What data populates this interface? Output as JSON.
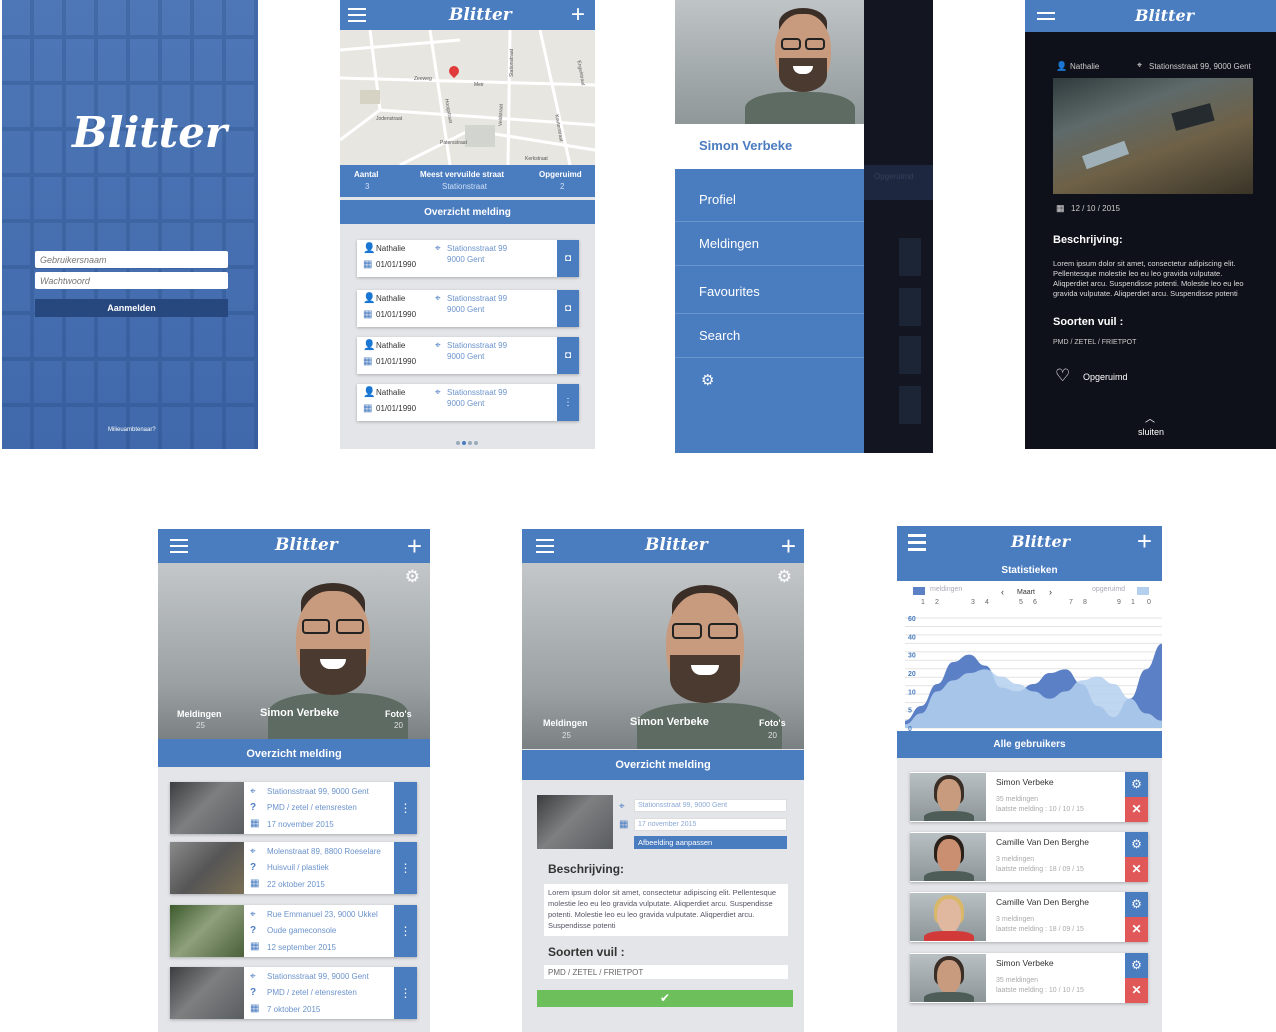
{
  "app": {
    "name": "Blitter"
  },
  "login": {
    "username_placeholder": "Gebruikersnaam",
    "password_placeholder": "Wachtwoord",
    "login_button": "Aanmelden",
    "forgot_link": "Milieuambtenaar?"
  },
  "map_screen": {
    "streets": [
      "Zeeweg",
      "Meir",
      "Stationstraat",
      "Kouterstraat",
      "Veldstraat",
      "Jodenstraat",
      "Hoogstraat",
      "Patersstraat",
      "Kerkstraat",
      "Engelstraat"
    ],
    "stats": [
      {
        "label": "Aantal",
        "value": "3"
      },
      {
        "label": "Meest vervuilde straat",
        "value": "Stationstraat"
      },
      {
        "label": "Opgeruimd",
        "value": "2"
      }
    ],
    "section_title": "Overzicht melding",
    "items": [
      {
        "user": "Nathalie",
        "date": "01/01/1990",
        "street": "Stationsstraat 99",
        "city": "9000 Gent",
        "action": "camera-icon"
      },
      {
        "user": "Nathalie",
        "date": "01/01/1990",
        "street": "Stationsstraat 99",
        "city": "9000 Gent",
        "action": "camera-icon"
      },
      {
        "user": "Nathalie",
        "date": "01/01/1990",
        "street": "Stationsstraat 99",
        "city": "9000 Gent",
        "action": "camera-icon"
      },
      {
        "user": "Nathalie",
        "date": "01/01/1990",
        "street": "Stationsstraat 99",
        "city": "9000 Gent",
        "action": "more-icon"
      }
    ]
  },
  "side_menu": {
    "user_name": "Simon Verbeke",
    "items": [
      "Profiel",
      "Meldingen",
      "Favourites",
      "Search"
    ],
    "bg_label": "Opgeruimd"
  },
  "detail": {
    "user": "Nathalie",
    "location": "Stationsstraat 99, 9000 Gent",
    "date": "12 / 10 / 2015",
    "description_title": "Beschrijving:",
    "description": "Lorem ipsum dolor sit amet, consectetur adipiscing elit. Pellentesque molestie leo eu leo gravida vulputate. Aliqperdiet arcu. Suspendisse potenti. Molestie leo eu leo gravida vulputate. Aliqperdiet arcu. Suspendisse potenti",
    "types_title": "Soorten vuil :",
    "types": "PMD / ZETEL / FRIETPOT",
    "cleaned_label": "Opgeruimd",
    "close_label": "sluiten"
  },
  "profile": {
    "user_name": "Simon Verbeke",
    "stat_left_label": "Meldingen",
    "stat_left_value": "25",
    "stat_right_label": "Foto's",
    "stat_right_value": "20",
    "section_title": "Overzicht melding",
    "items": [
      {
        "address": "Stationsstraat 99, 9000 Gent",
        "types": "PMD / zetel / etensresten",
        "date": "17 november 2015"
      },
      {
        "address": "Molenstraat 89, 8800 Roeselare",
        "types": "Huisvuil / plastiek",
        "date": "22 oktober 2015"
      },
      {
        "address": "Rue Emmanuel 23, 9000 Ukkel",
        "types": "Oude gameconsole",
        "date": "12 september 2015"
      },
      {
        "address": "Stationsstraat 99, 9000 Gent",
        "types": "PMD / zetel / etensresten",
        "date": "7 oktober 2015"
      }
    ]
  },
  "edit": {
    "user_name": "Simon Verbeke",
    "stat_left_label": "Meldingen",
    "stat_left_value": "25",
    "stat_right_label": "Foto's",
    "stat_right_value": "20",
    "section_title": "Overzicht melding",
    "address_value": "Stationsstraat 99, 9000 Gent",
    "date_value": "17 november 2015",
    "change_image_button": "Afbeelding aanpassen",
    "description_title": "Beschrijving:",
    "description": "Lorem ipsum dolor sit amet, consectetur adipiscing elit. Pellentesque molestie leo eu leo gravida vulputate. Aliqperdiet arcu. Suspendisse potenti. Molestie leo eu leo gravida vulputate. Aliqperdiet arcu. Suspendisse potenti",
    "types_title": "Soorten vuil :",
    "types_value": "PMD / ZETEL / FRIETPOT",
    "confirm_icon": "check-icon"
  },
  "stats_screen": {
    "title": "Statistieken",
    "legend_a": "meldingen",
    "legend_b": "opgeruimd",
    "month": "Maart",
    "day_ticks": [
      "1",
      "2",
      "3",
      "4",
      "5",
      "6",
      "7",
      "8",
      "9",
      "1",
      "0"
    ],
    "section_title": "Alle gebruikers",
    "users": [
      {
        "name": "Simon Verbeke",
        "count": "35 meldingen",
        "last": "laatste melding : 10 / 10 / 15"
      },
      {
        "name": "Camille Van Den Berghe",
        "count": "3 meldingen",
        "last": "laatste melding : 18 / 09 / 15"
      },
      {
        "name": "Camille Van Den Berghe",
        "count": "3 meldingen",
        "last": "laatste melding : 18 / 09 / 15"
      },
      {
        "name": "Simon Verbeke",
        "count": "35 meldingen",
        "last": "laatste melding : 10 / 10 / 15"
      }
    ]
  },
  "chart_data": {
    "type": "area",
    "title": "",
    "xlabel": "",
    "ylabel": "",
    "y_ticks": [
      0,
      5,
      10,
      20,
      30,
      40,
      60
    ],
    "ylim": [
      0,
      60
    ],
    "x": [
      0,
      1,
      2,
      3,
      4,
      5,
      6,
      7,
      8,
      9,
      10,
      11,
      12,
      13,
      14,
      15,
      16
    ],
    "grid": true,
    "legend": "top",
    "series": [
      {
        "name": "meldingen",
        "color": "#5b80c6",
        "values": [
          2,
          6,
          14,
          26,
          30,
          24,
          12,
          10,
          14,
          20,
          22,
          14,
          6,
          3,
          8,
          22,
          36
        ]
      },
      {
        "name": "opgeruimd",
        "color": "#b5d0ef",
        "values": [
          1,
          4,
          10,
          16,
          20,
          22,
          18,
          14,
          10,
          8,
          10,
          16,
          18,
          14,
          8,
          4,
          2
        ]
      }
    ]
  },
  "colors": {
    "primary": "#4a7cc0",
    "dark": "#141622",
    "danger": "#e05858",
    "success": "#6cbf5a"
  }
}
